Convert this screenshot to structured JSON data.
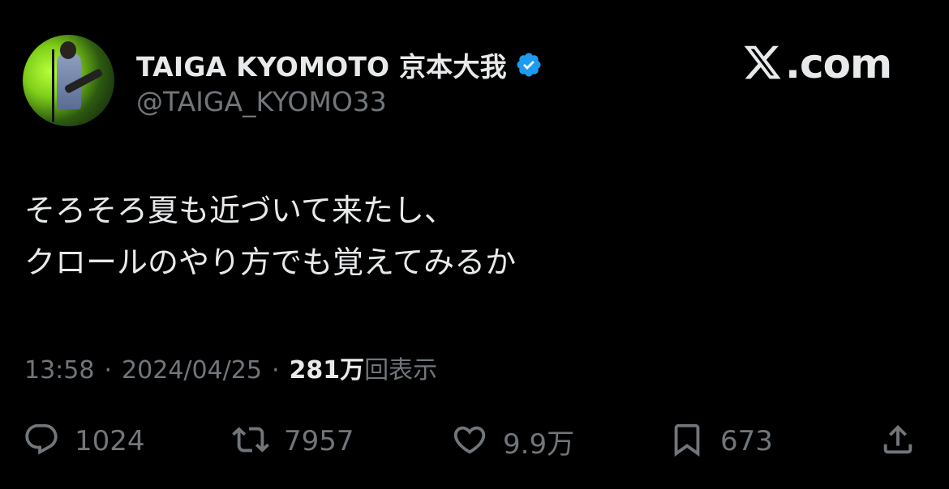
{
  "header": {
    "display_name": "TAIGA KYOMOTO 京本大我",
    "handle": "@TAIGA_KYOMO33",
    "verified": true,
    "brand_text": ".com"
  },
  "tweet": {
    "lines": [
      "そろそろ夏も近づいて来たし、",
      "クロールのやり方でも覚えてみるか"
    ]
  },
  "meta": {
    "time": "13:58",
    "date": "2024/04/25",
    "views_count": "281万",
    "views_label": "回表示",
    "separator": "·"
  },
  "actions": {
    "reply_count": "1024",
    "retweet_count": "7957",
    "like_count": "9.9万",
    "bookmark_count": "673"
  },
  "icons": {
    "verified": "verified-badge-icon",
    "brand": "x-logo-icon",
    "reply": "reply-icon",
    "retweet": "retweet-icon",
    "like": "heart-icon",
    "bookmark": "bookmark-icon",
    "share": "share-icon"
  },
  "colors": {
    "background": "#000000",
    "text_primary": "#e7e9ea",
    "text_secondary": "#71767b",
    "verified_blue": "#1d9bf0"
  }
}
